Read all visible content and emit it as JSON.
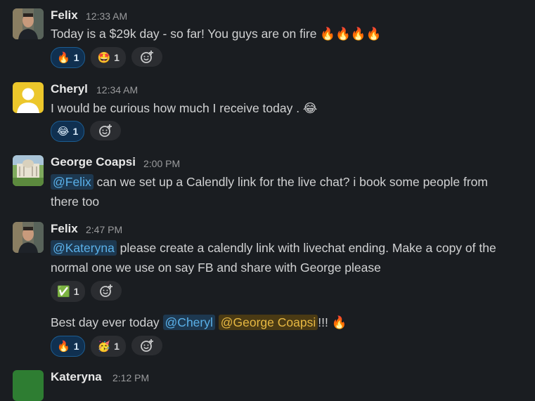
{
  "messages": [
    {
      "author": "Felix",
      "time": "12:33 AM",
      "text": "Today is a $29k day - so far! You guys are on fire 🔥🔥🔥🔥",
      "reactions": [
        {
          "emoji": "🔥",
          "count": "1",
          "active": true
        },
        {
          "emoji": "🤩",
          "count": "1",
          "active": false
        }
      ]
    },
    {
      "author": "Cheryl",
      "time": "12:34 AM",
      "text": "I would be curious how much I receive today . 😂",
      "reactions": [
        {
          "emoji": "😂",
          "count": "1",
          "active": true
        }
      ]
    },
    {
      "author": "George Coapsi",
      "time": "2:00 PM",
      "mention": "@Felix",
      "text_line1": " can we set up a Calendly link for the live chat? i book some people from",
      "text_line2": "there too"
    },
    {
      "author": "Felix",
      "time": "2:47 PM",
      "mention": "@Kateryna",
      "text_line1": " please create a calendly link with livechat ending.  Make a copy of the",
      "text_line2": "normal one we use on say FB and share with George please",
      "reactions": [
        {
          "emoji": "✅",
          "count": "1",
          "active": false
        }
      ]
    },
    {
      "text_prefix": "Best day ever today ",
      "mention1": "@Cheryl",
      "mention2": "@George Coapsi",
      "text_suffix": "!!! 🔥",
      "reactions": [
        {
          "emoji": "🔥",
          "count": "1",
          "active": true
        },
        {
          "emoji": "🥳",
          "count": "1",
          "active": false
        }
      ]
    },
    {
      "author": "Kateryna",
      "time": "2:12 PM"
    }
  ],
  "icons": {
    "add_reaction": "add-reaction-icon"
  },
  "colors": {
    "background": "#1a1d21",
    "mention_text": "#5ab0e8",
    "self_mention_bg": "#4a3a14",
    "reaction_active": "#103050"
  }
}
